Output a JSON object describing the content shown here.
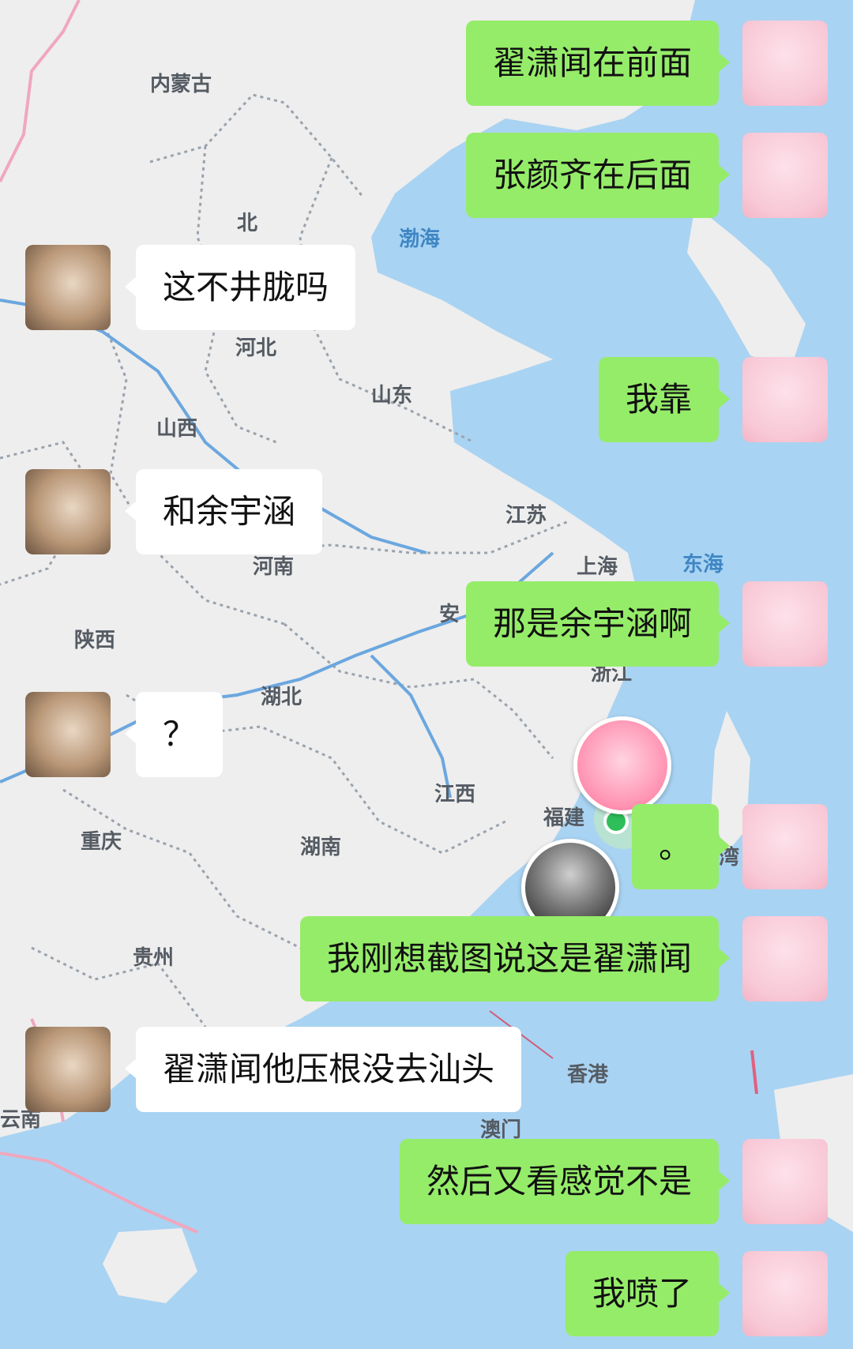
{
  "map": {
    "places": [
      {
        "id": "neimenggu",
        "label": "内蒙古"
      },
      {
        "id": "bei",
        "label": "北"
      },
      {
        "id": "bohai",
        "label": "渤海"
      },
      {
        "id": "hebei",
        "label": "河北"
      },
      {
        "id": "shandong",
        "label": "山东"
      },
      {
        "id": "shanxi",
        "label": "山西"
      },
      {
        "id": "jiangsu",
        "label": "江苏"
      },
      {
        "id": "henan",
        "label": "河南"
      },
      {
        "id": "shanghai",
        "label": "上海"
      },
      {
        "id": "donghai",
        "label": "东海"
      },
      {
        "id": "shaanxi",
        "label": "陕西"
      },
      {
        "id": "an",
        "label": "安"
      },
      {
        "id": "zhejiang",
        "label": "浙江"
      },
      {
        "id": "hubei",
        "label": "湖北"
      },
      {
        "id": "jiangxi",
        "label": "江西"
      },
      {
        "id": "fujian",
        "label": "福建"
      },
      {
        "id": "chongqing",
        "label": "重庆"
      },
      {
        "id": "hunan",
        "label": "湖南"
      },
      {
        "id": "wan",
        "label": "湾"
      },
      {
        "id": "guizhou",
        "label": "贵州"
      },
      {
        "id": "xianggang",
        "label": "香港"
      },
      {
        "id": "yunnan",
        "label": "云南"
      },
      {
        "id": "aomen",
        "label": "澳门"
      }
    ]
  },
  "messages": [
    {
      "sender": "me",
      "text": "翟潇闻在前面"
    },
    {
      "sender": "me",
      "text": "张颜齐在后面"
    },
    {
      "sender": "other",
      "text": "这不井胧吗"
    },
    {
      "sender": "me",
      "text": "我靠"
    },
    {
      "sender": "other",
      "text": "和余宇涵"
    },
    {
      "sender": "me",
      "text": "那是余宇涵啊"
    },
    {
      "sender": "other",
      "text": "？"
    },
    {
      "sender": "me",
      "text": "。"
    },
    {
      "sender": "me",
      "text": "我刚想截图说这是翟潇闻"
    },
    {
      "sender": "other",
      "text": "翟潇闻他压根没去汕头"
    },
    {
      "sender": "me",
      "text": "然后又看感觉不是"
    },
    {
      "sender": "me",
      "text": "我喷了"
    }
  ],
  "colors": {
    "sea": "#a9d3f2",
    "land": "#eeeeee",
    "bubble_me": "#95ec69",
    "bubble_other": "#ffffff"
  }
}
